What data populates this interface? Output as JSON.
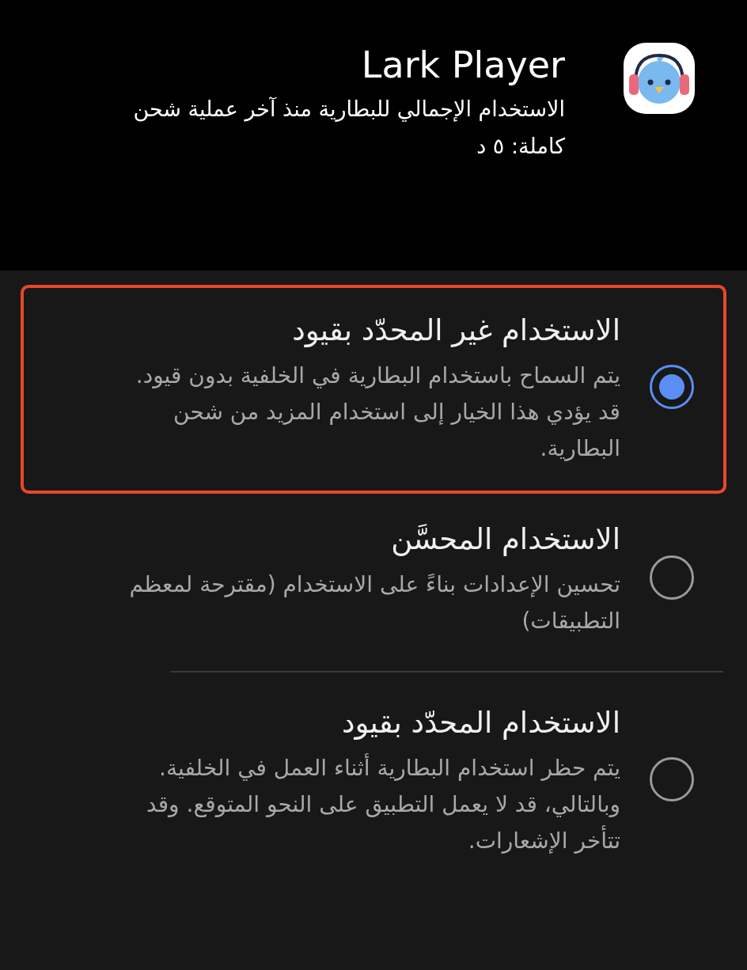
{
  "app": {
    "name": "Lark Player",
    "usage": "الاستخدام الإجمالي للبطارية منذ آخر عملية شحن كاملة: ٥ د"
  },
  "option_groups": [
    {
      "options": [
        {
          "title": "الاستخدام غير المحدّد بقيود",
          "description": "يتم السماح باستخدام البطارية في الخلفية بدون قيود. قد يؤدي هذا الخيار إلى استخدام المزيد من شحن البطارية.",
          "selected": true,
          "highlighted": true
        },
        {
          "title": "الاستخدام المحسَّن",
          "description": "تحسين الإعدادات بناءً على الاستخدام (مقترحة لمعظم التطبيقات)",
          "selected": false,
          "highlighted": false
        }
      ]
    },
    {
      "options": [
        {
          "title": "الاستخدام المحدّد بقيود",
          "description": "يتم حظر استخدام البطارية أثناء العمل في الخلفية. وبالتالي، قد لا يعمل التطبيق على النحو المتوقع. وقد تتأخر الإشعارات.",
          "selected": false,
          "highlighted": false
        }
      ]
    }
  ]
}
